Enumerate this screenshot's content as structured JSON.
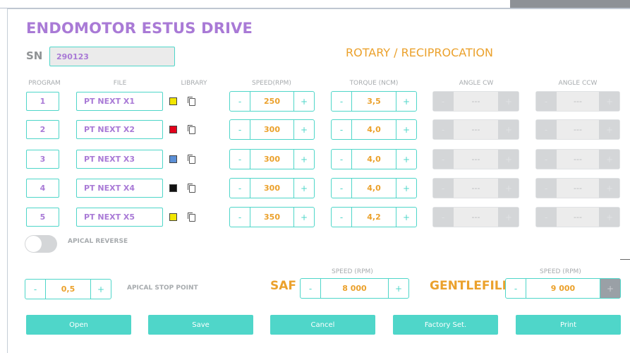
{
  "app": {
    "title": "ENDOMOTOR ESTUS DRIVE",
    "sn_label": "SN",
    "sn_value": "290123",
    "mode": "ROTARY / RECIPROCATION"
  },
  "headers": {
    "program": "PROGRAM",
    "file": "FILE",
    "library": "LIBRARY",
    "speed": "SPEED(RPM)",
    "torque": "TORQUE (NCM)",
    "angle_cw": "ANGLE CW",
    "angle_ccw": "ANGLE CCW"
  },
  "stepper_symbols": {
    "minus": "-",
    "plus": "+"
  },
  "programs": [
    {
      "number": "1",
      "file": "PT NEXT X1",
      "color": "#f2e600",
      "speed": "250",
      "torque": "3,5",
      "angle_cw": "---",
      "angle_ccw": "---"
    },
    {
      "number": "2",
      "file": "PT NEXT X2",
      "color": "#e3001b",
      "speed": "300",
      "torque": "4,0",
      "angle_cw": "---",
      "angle_ccw": "---"
    },
    {
      "number": "3",
      "file": "PT NEXT X3",
      "color": "#5b8fd6",
      "speed": "300",
      "torque": "4,0",
      "angle_cw": "---",
      "angle_ccw": "---"
    },
    {
      "number": "4",
      "file": "PT NEXT X4",
      "color": "#111111",
      "speed": "300",
      "torque": "4,0",
      "angle_cw": "---",
      "angle_ccw": "---"
    },
    {
      "number": "5",
      "file": "PT NEXT X5",
      "color": "#f2e600",
      "speed": "350",
      "torque": "4,2",
      "angle_cw": "---",
      "angle_ccw": "---"
    }
  ],
  "apical_reverse": {
    "label": "APICAL REVERSE",
    "on": false
  },
  "apical_stop": {
    "value": "0,5",
    "label": "APICAL STOP POINT"
  },
  "saf": {
    "label": "SAF",
    "speed_label": "SPEED (RPM)",
    "value": "8 000"
  },
  "gentlefile": {
    "label": "GENTLEFILE",
    "speed_label": "SPEED (RPM)",
    "value": "9 000"
  },
  "buttons": {
    "open": "Open",
    "save": "Save",
    "cancel": "Cancel",
    "factory": "Factory Set.",
    "print": "Print"
  },
  "colors": {
    "accent_teal": "#4fd6c9",
    "title_purple": "#a97ad6",
    "value_orange": "#eba12c",
    "disabled_gray": "#e0e2e4"
  }
}
